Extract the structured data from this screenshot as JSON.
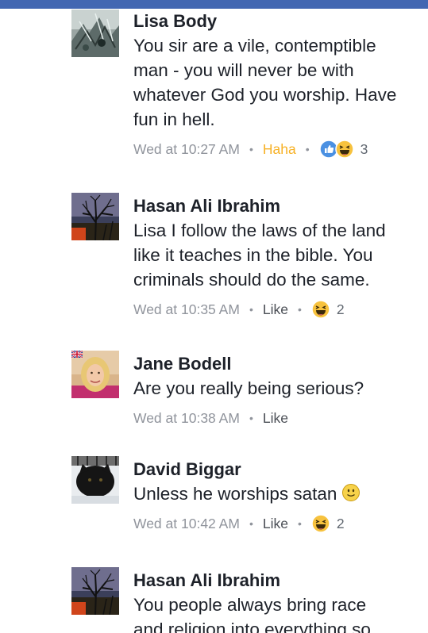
{
  "comments": [
    {
      "author": "Lisa Body",
      "text_lines": [
        "You sir are a vile, contemptible",
        "man - you will never be with",
        "whatever God you worship.  Have",
        "fun in hell."
      ],
      "time": "Wed at 10:27 AM",
      "action": "Haha",
      "reaction_icons": [
        "like-icon",
        "haha-icon"
      ],
      "reaction_count": "3"
    },
    {
      "author": "Hasan Ali Ibrahim",
      "text_lines": [
        "Lisa I follow the laws of the land",
        "like it teaches in the bible. You",
        "criminals should do the same."
      ],
      "time": "Wed at 10:35 AM",
      "action": "Like",
      "reaction_icons": [
        "haha-icon"
      ],
      "reaction_count": "2"
    },
    {
      "author": "Jane Bodell",
      "text_lines": [
        "Are you really being serious?"
      ],
      "time": "Wed at 10:38 AM",
      "action": "Like"
    },
    {
      "author": "David Biggar",
      "text_lines": [
        "Unless he worships satan"
      ],
      "text_emoji": "smiley-icon",
      "time": "Wed at 10:42 AM",
      "action": "Like",
      "reaction_icons": [
        "haha-icon"
      ],
      "reaction_count": "2"
    },
    {
      "author": "Hasan Ali Ibrahim",
      "text_lines": [
        "You people always bring race",
        "and religion into everything so"
      ]
    }
  ],
  "separator": "•",
  "colors": {
    "top_bar": "#4267b2",
    "haha_action": "#f7b125",
    "meta_text": "#90949c"
  }
}
